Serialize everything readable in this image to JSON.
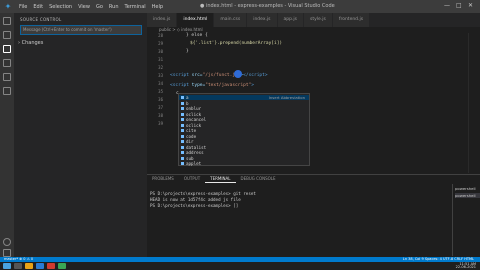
{
  "menu": {
    "items": [
      "File",
      "Edit",
      "Selection",
      "View",
      "Go",
      "Run",
      "Terminal",
      "Help"
    ],
    "window_title": "● index.html - express-examples - Visual Studio Code",
    "controls": [
      "—",
      "□",
      "✕"
    ]
  },
  "sidebar": {
    "header": "SOURCE CONTROL",
    "message_placeholder": "Message (Ctrl+Enter to commit on 'master')",
    "changes_label": "Changes"
  },
  "tabs": [
    "index.js",
    "index.html",
    "main.css",
    "index.js",
    "app.js",
    "style.js",
    "frontend.js"
  ],
  "breadcrumb": "public > ◇ index.html",
  "code": {
    "line_numbers": [
      "28",
      "29",
      "30",
      "31",
      "32",
      "33",
      "34",
      "35",
      "36",
      "37",
      "38",
      "39"
    ],
    "line_1": "} else {",
    "line_2": "${'.list'}.prepend(numberArray[i])",
    "line_3": "}",
    "line_4a": "<script",
    "line_4b": " src=",
    "line_4c": "\"/js/funct.js\"",
    "line_4d": "></",
    "line_4e": "script",
    "line_4f": ">",
    "line_5a": "<script",
    "line_5b": " type=",
    "line_5c": "\"text/javascript\"",
    "line_5d": ">",
    "line_6": "c"
  },
  "suggest": {
    "items": [
      "a",
      "b",
      "onblur",
      "oclick",
      "oncancel",
      "oclick",
      "cite",
      "code",
      "dir",
      "datalist",
      "address",
      "sub",
      "applet"
    ],
    "selected_detail": "Insert Abbreviation"
  },
  "panel": {
    "tabs": [
      "PROBLEMS",
      "OUTPUT",
      "TERMINAL",
      "DEBUG CONSOLE"
    ],
    "active_tab": "TERMINAL",
    "term_lines": [
      "PS D:\\projects\\express-examples> git reset",
      "HEAD is now at 1d57f4c added js file",
      "PS D:\\projects\\express-examples> []"
    ],
    "terminal_list": [
      "powershell",
      "powershell"
    ]
  },
  "status": {
    "left": "master*  ⊗ 0 ⚠ 0",
    "right": "Ln 38, Col 9   Spaces: 4   UTF-8   CRLF   HTML"
  },
  "taskbar": {
    "time": "11:51 AM",
    "date": "22-06-2021"
  },
  "colors": {
    "accent": "#007acc",
    "cursor_dot": "#2f6bd6"
  }
}
